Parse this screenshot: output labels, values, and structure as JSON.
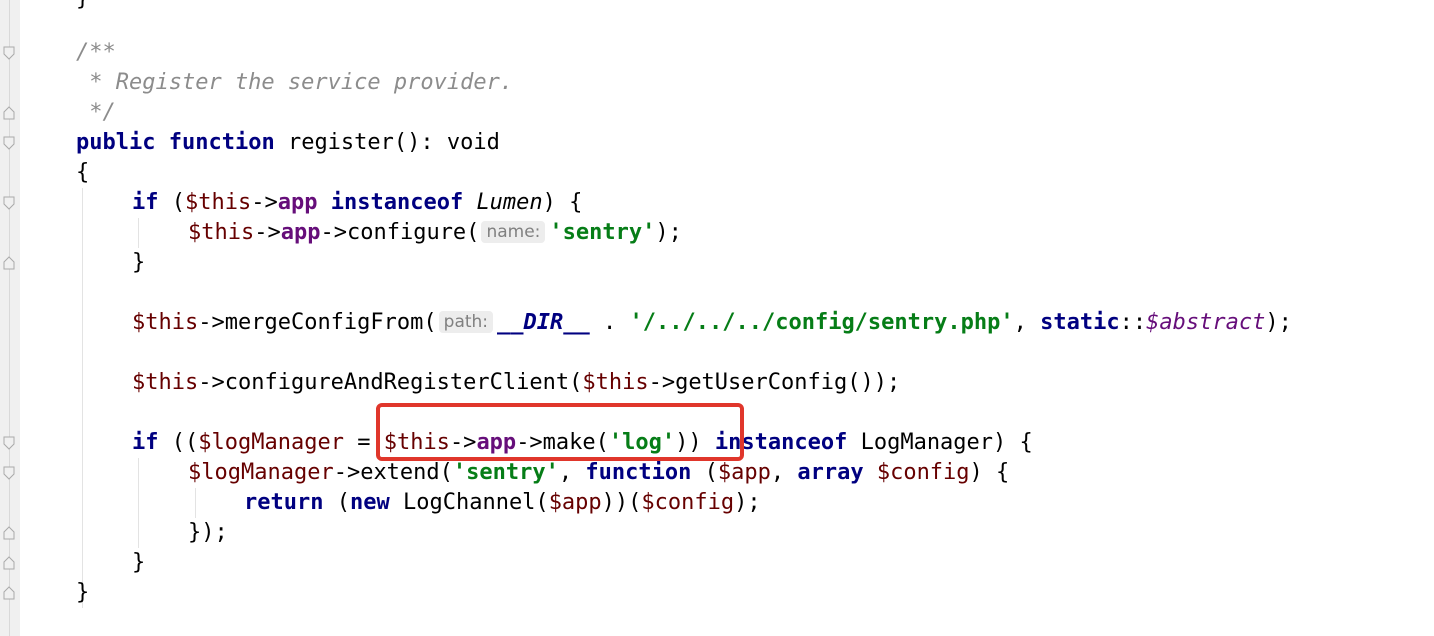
{
  "code": {
    "l0": "}",
    "l1": "/**",
    "l2": " * Register the service provider.",
    "l3": " */",
    "l4": {
      "kw1": "public",
      "kw2": "function",
      "rest": " register(): void"
    },
    "l5": "{",
    "l6": {
      "kw_if": "if",
      "open": " (",
      "this": "$this",
      "arrow": "->",
      "app": "app",
      "kw_inst": "instanceof",
      "cls": "Lumen",
      "close": ") {"
    },
    "l7": {
      "this": "$this",
      "arrow1": "->",
      "app": "app",
      "call": "->configure(",
      "hint": "name:",
      "str": "'sentry'",
      "end": ");"
    },
    "l8": "}",
    "l9": {
      "this": "$this",
      "call": "->mergeConfigFrom(",
      "hint": "path:",
      "const": "__DIR__",
      "dot": " . ",
      "str": "'/../../../config/sentry.php'",
      "comma": ", ",
      "kw_static": "static",
      "dc": "::",
      "sfield": "$abstract",
      "end": ");"
    },
    "l10": {
      "this1": "$this",
      "call": "->configureAndRegisterClient(",
      "this2": "$this",
      "end": "->getUserConfig());"
    },
    "l11": {
      "kw_if": "if",
      "open": " ((",
      "logm": "$logManager",
      "eq": " = ",
      "this": "$this",
      "arrow": "->",
      "app": "app",
      "make": "->make(",
      "str": "'log'",
      "close": ")) ",
      "kw_inst": "instanceof",
      "cls": " LogManager) {"
    },
    "l12": {
      "logm": "$logManager",
      "ext": "->extend(",
      "str": "'sentry'",
      "comma": ", ",
      "kw_fn": "function",
      "open": " (",
      "app": "$app",
      "comma2": ", ",
      "kw_array": "array",
      "sp": " ",
      "config": "$config",
      "end": ") {"
    },
    "l13": {
      "kw_return": "return",
      "open": " (",
      "kw_new": "new",
      "cls": " LogChannel(",
      "app": "$app",
      "mid": "))(",
      "config": "$config",
      "end": ");"
    },
    "l14": "});",
    "l15": "}",
    "l16": "}"
  }
}
